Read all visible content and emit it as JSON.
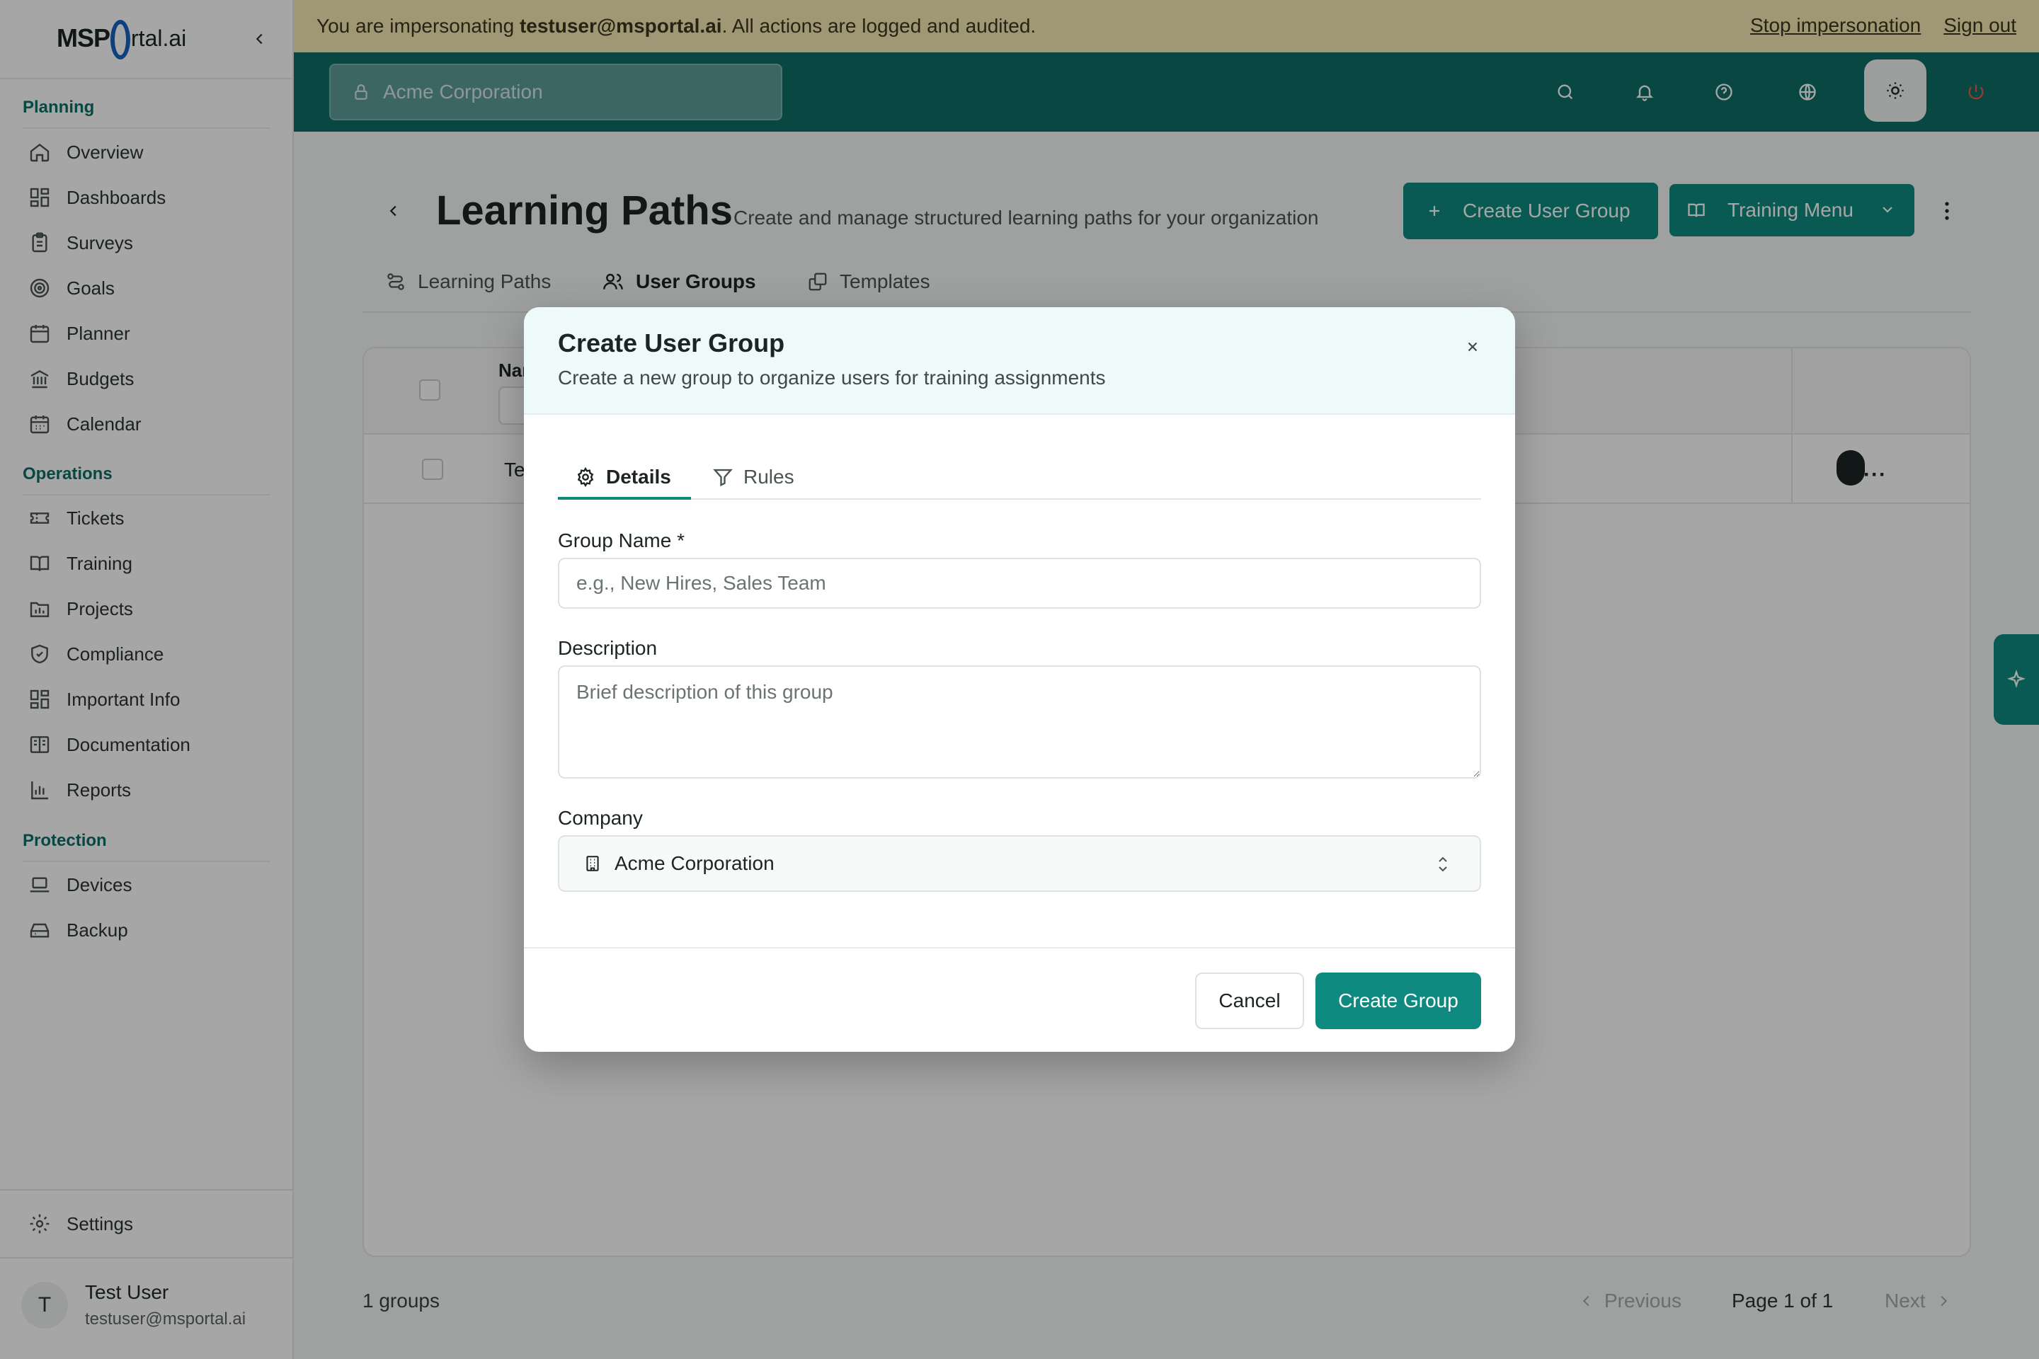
{
  "brand": {
    "logo_text": "MSPortal.ai",
    "logo_left": "MSP",
    "logo_right": "rtal.ai"
  },
  "sidebar": {
    "sections": [
      {
        "title": "Planning",
        "items": [
          {
            "label": "Overview",
            "icon": "home-icon"
          },
          {
            "label": "Dashboards",
            "icon": "dashboard-icon"
          },
          {
            "label": "Surveys",
            "icon": "clipboard-icon"
          },
          {
            "label": "Goals",
            "icon": "target-icon"
          },
          {
            "label": "Planner",
            "icon": "calendar-icon"
          },
          {
            "label": "Budgets",
            "icon": "bank-icon"
          },
          {
            "label": "Calendar",
            "icon": "calendar-grid-icon"
          }
        ]
      },
      {
        "title": "Operations",
        "items": [
          {
            "label": "Tickets",
            "icon": "ticket-icon"
          },
          {
            "label": "Training",
            "icon": "book-icon"
          },
          {
            "label": "Projects",
            "icon": "folder-chart-icon"
          },
          {
            "label": "Compliance",
            "icon": "shield-icon"
          },
          {
            "label": "Important Info",
            "icon": "grid-icon"
          },
          {
            "label": "Documentation",
            "icon": "book-open-icon"
          },
          {
            "label": "Reports",
            "icon": "bar-chart-icon"
          }
        ]
      },
      {
        "title": "Protection",
        "items": [
          {
            "label": "Devices",
            "icon": "laptop-icon"
          },
          {
            "label": "Backup",
            "icon": "hard-drive-icon"
          }
        ]
      }
    ],
    "settings_label": "Settings",
    "user": {
      "initial": "T",
      "name": "Test User",
      "email": "testuser@msportal.ai"
    }
  },
  "impersonation": {
    "prefix": "You are impersonating ",
    "email": "testuser@msportal.ai",
    "suffix": ". All actions are logged and audited.",
    "stop_label": "Stop impersonation",
    "signout_label": "Sign out",
    "color": "#f6e9b3"
  },
  "topbar": {
    "company": "Acme Corporation",
    "color": "#0e6e68"
  },
  "page": {
    "title": "Learning Paths",
    "subtitle": "Create and manage structured learning paths for your organization",
    "create_user_group_label": "Create User Group",
    "training_menu_label": "Training Menu",
    "tabs": [
      {
        "label": "Learning Paths",
        "icon": "path-icon",
        "active": false
      },
      {
        "label": "User Groups",
        "icon": "users-icon",
        "active": true
      },
      {
        "label": "Templates",
        "icon": "copy-icon",
        "active": false
      }
    ],
    "table": {
      "col_name_partial": "Nar",
      "row_name_partial": "Te"
    },
    "footer": {
      "count": "1 groups",
      "previous": "Previous",
      "page_info": "Page 1 of 1",
      "next": "Next"
    }
  },
  "modal": {
    "title": "Create User Group",
    "subtitle": "Create a new group to organize users for training assignments",
    "tabs": [
      {
        "label": "Details",
        "icon": "gear-icon",
        "active": true
      },
      {
        "label": "Rules",
        "icon": "filter-icon",
        "active": false
      }
    ],
    "group_name_label": "Group Name *",
    "group_name_placeholder": "e.g., New Hires, Sales Team",
    "group_name_value": "",
    "description_label": "Description",
    "description_placeholder": "Brief description of this group",
    "company_label": "Company",
    "company_value": "Acme Corporation",
    "cancel_label": "Cancel",
    "create_label": "Create Group"
  },
  "colors": {
    "accent": "#0f8a80",
    "accent_dark": "#0e6e68",
    "section_title": "#0d6e68"
  }
}
